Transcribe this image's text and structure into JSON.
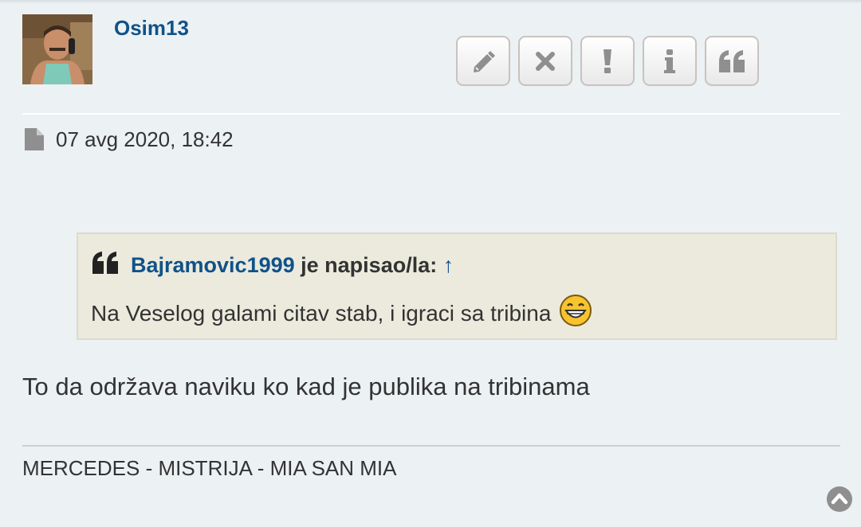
{
  "post": {
    "author": "Osim13",
    "date": "07 avg 2020, 18:42",
    "body": "To da održava naviku ko kad je publika na tribinama",
    "signature": "MERCEDES - MISTRIJA - MIA SAN MIA"
  },
  "actions": [
    {
      "name": "edit",
      "icon": "pencil-icon"
    },
    {
      "name": "delete",
      "icon": "close-icon"
    },
    {
      "name": "report",
      "icon": "exclamation-icon"
    },
    {
      "name": "info",
      "icon": "info-icon"
    },
    {
      "name": "quote",
      "icon": "quote-icon"
    }
  ],
  "quote": {
    "author": "Bajramovic1999",
    "wrote_label": "je napisao/la:",
    "arrow": "↑",
    "text": "Na Veselog galami citav stab, i igraci sa tribina"
  },
  "colors": {
    "background": "#ecf1f3",
    "link": "#105289",
    "quote_bg": "#ebeadd",
    "text": "#333333"
  }
}
